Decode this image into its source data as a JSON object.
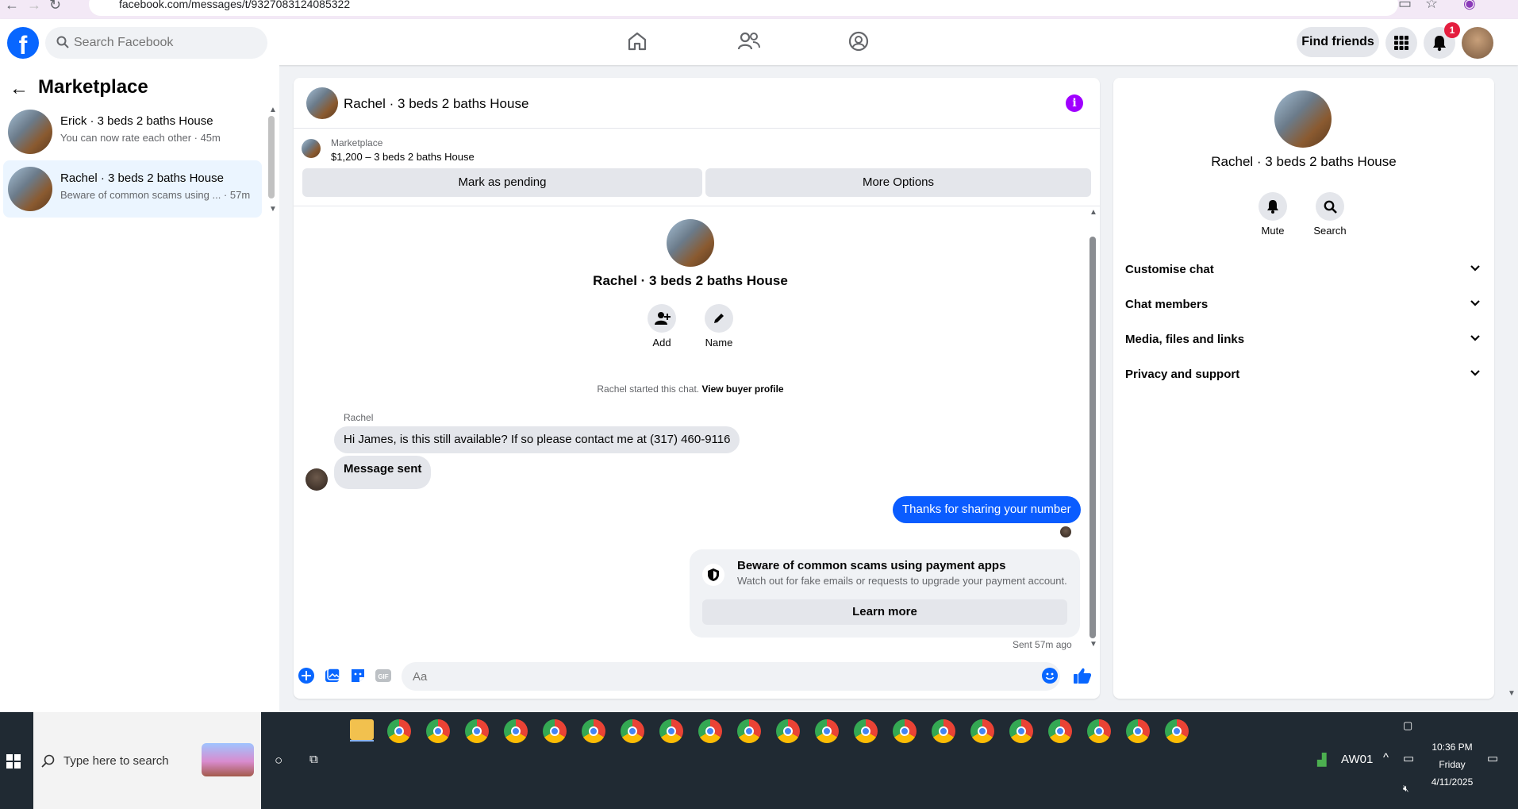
{
  "browser": {
    "url": "facebook.com/messages/t/9327083124085322"
  },
  "topnav": {
    "search_placeholder": "Search Facebook",
    "find_friends_label": "Find friends",
    "notification_count": "1",
    "logo_letter": "f"
  },
  "left_panel": {
    "title": "Marketplace",
    "conversations": [
      {
        "title": "Erick · 3 beds 2 baths House",
        "subtitle": "You can now rate each other · 45m",
        "active": false
      },
      {
        "title": "Rachel · 3 beds 2 baths House",
        "subtitle": "Beware of common scams using ... · 57m",
        "active": true
      }
    ]
  },
  "chat": {
    "header_title": "Rachel · 3 beds 2 baths House",
    "listing_source": "Marketplace",
    "listing_title": "$1,200 – 3 beds 2 baths House",
    "mark_pending_label": "Mark as pending",
    "more_options_label": "More Options",
    "profile_name": "Rachel · 3 beds 2 baths House",
    "add_label": "Add",
    "name_label": "Name",
    "started_text": "Rachel started this chat.",
    "view_buyer_profile_label": "View buyer profile",
    "sender_name": "Rachel",
    "messages": [
      {
        "from": "Rachel",
        "text": "Hi James, is this still available? If so please contact me at (317) 460-9116"
      },
      {
        "from": "Rachel",
        "text": "Message sent"
      },
      {
        "from": "me",
        "text": "Thanks for sharing your number"
      }
    ],
    "scam_card": {
      "title": "Beware of common scams using payment apps",
      "subtitle": "Watch out for fake emails or requests to upgrade your payment account.",
      "button_label": "Learn more"
    },
    "sent_status": "Sent 57m ago",
    "composer_placeholder": "Aa"
  },
  "right_panel": {
    "name": "Rachel · 3 beds 2 baths House",
    "mute_label": "Mute",
    "search_label": "Search",
    "sections": [
      "Customise chat",
      "Chat members",
      "Media, files and links",
      "Privacy and support"
    ]
  },
  "taskbar": {
    "search_placeholder": "Type here to search",
    "network_label": "AW01",
    "time": "10:36 PM",
    "day": "Friday",
    "date": "4/11/2025"
  },
  "colors": {
    "brand_blue": "#0866ff",
    "outgoing_bubble": "#0a5cff",
    "info_purple": "#a000ff",
    "badge_red": "#e41e3f"
  }
}
